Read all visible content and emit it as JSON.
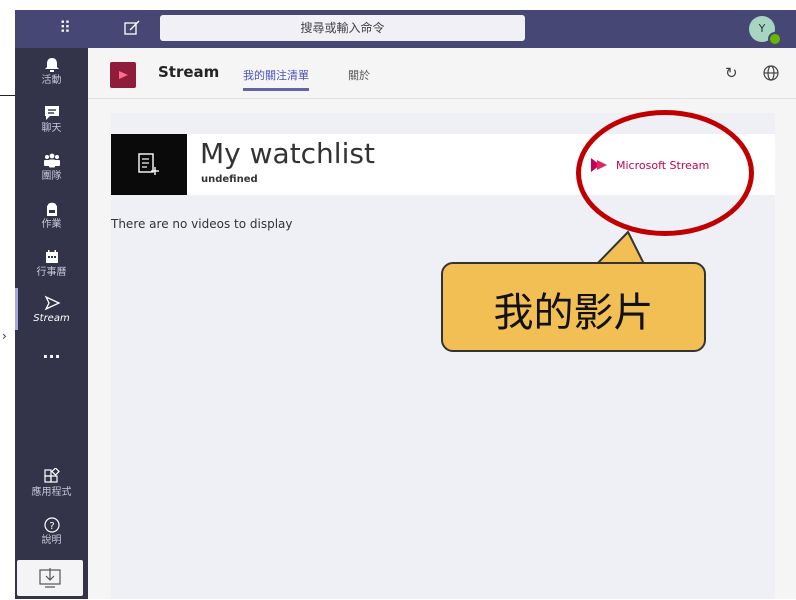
{
  "topbar": {
    "search_placeholder": "搜尋或輸入命令",
    "avatar_initial": "Y"
  },
  "rail": {
    "items": [
      {
        "label": "活動",
        "icon": "bell-icon"
      },
      {
        "label": "聊天",
        "icon": "chat-icon"
      },
      {
        "label": "團隊",
        "icon": "teams-icon"
      },
      {
        "label": "作業",
        "icon": "backpack-icon"
      },
      {
        "label": "行事曆",
        "icon": "calendar-icon"
      },
      {
        "label": "Stream",
        "icon": "stream-icon"
      },
      {
        "label": "...",
        "icon": "more-icon"
      },
      {
        "label": "應用程式",
        "icon": "apps-icon"
      },
      {
        "label": "說明",
        "icon": "help-icon"
      }
    ]
  },
  "app": {
    "name": "Stream",
    "tabs": [
      {
        "label": "我的關注清單",
        "active": true
      },
      {
        "label": "關於",
        "active": false
      }
    ]
  },
  "watchlist": {
    "title": "My watchlist",
    "subtitle": "undefined",
    "brand": "Microsoft Stream",
    "empty_text": "There are no videos to display"
  },
  "annotation": {
    "callout_text": "我的影片"
  },
  "colors": {
    "topbar": "#464775",
    "rail": "#33344a",
    "accent": "#6264a7",
    "brand": "#c30052",
    "callout": "#f2bf55",
    "ellipse": "#c00000"
  }
}
